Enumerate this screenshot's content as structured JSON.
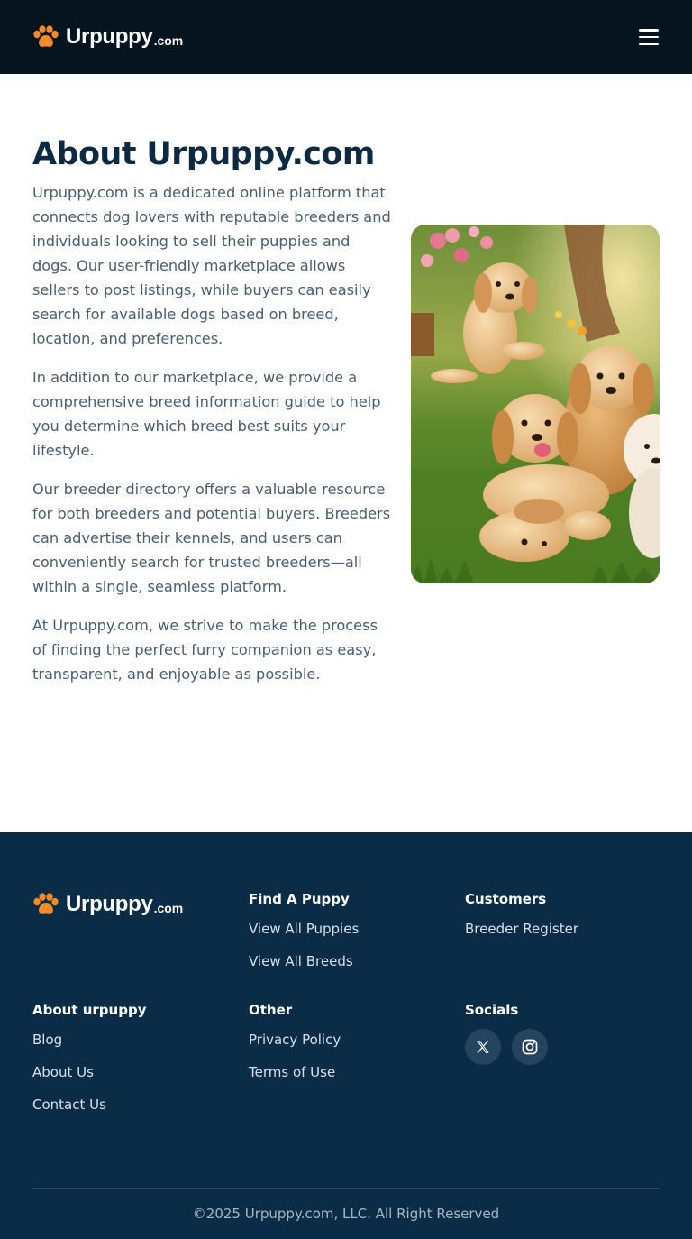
{
  "header": {
    "logo_name": "Urpuppy",
    "logo_tld": ".com",
    "menu_icon": "hamburger-menu-icon"
  },
  "about": {
    "title": "About Urpuppy.com",
    "paragraphs": [
      "Urpuppy.com is a dedicated online platform that connects dog lovers with reputable breeders and individuals looking to sell their puppies and dogs. Our user-friendly marketplace allows sellers to post listings, while buyers can easily search for available dogs based on breed, location, and preferences.",
      "In addition to our marketplace, we provide a comprehensive breed information guide to help you determine which breed best suits your lifestyle.",
      "Our breeder directory offers a valuable resource for both breeders and potential buyers. Breeders can advertise their kennels, and users can conveniently search for trusted breeders—all within a single, seamless platform.",
      "At Urpuppy.com, we strive to make the process of finding the perfect furry companion as easy, transparent, and enjoyable as possible."
    ],
    "image": "golden-retriever-puppies-in-garden"
  },
  "footer": {
    "logo_name": "Urpuppy",
    "logo_tld": ".com",
    "find_a_puppy": {
      "title": "Find A Puppy",
      "links": [
        "View All Puppies",
        "View All Breeds"
      ]
    },
    "customers": {
      "title": "Customers",
      "links": [
        "Breeder Register"
      ]
    },
    "about_urpuppy": {
      "title": "About urpuppy",
      "links": [
        "Blog",
        "About Us",
        "Contact Us"
      ]
    },
    "other": {
      "title": "Other",
      "links": [
        "Privacy Policy",
        "Terms of Use"
      ]
    },
    "socials": {
      "title": "Socials",
      "icons": [
        "x-twitter-icon",
        "instagram-icon"
      ]
    },
    "copyright": "©2025 Urpuppy.com, LLC. All Right Reserved"
  },
  "colors": {
    "header_bg": "#06141f",
    "footer_bg": "#0b2c47",
    "brand_orange": "#f28c28",
    "title_navy": "#0e2a42"
  }
}
